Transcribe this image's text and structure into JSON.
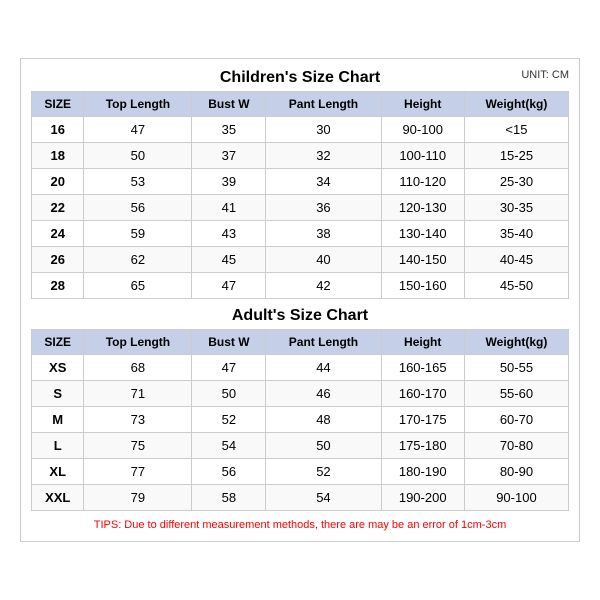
{
  "mainTitle": "Children's Size Chart",
  "unitLabel": "UNIT: CM",
  "childrenHeaders": [
    "SIZE",
    "Top Length",
    "Bust W",
    "Pant Length",
    "Height",
    "Weight(kg)"
  ],
  "childrenRows": [
    [
      "16",
      "47",
      "35",
      "30",
      "90-100",
      "<15"
    ],
    [
      "18",
      "50",
      "37",
      "32",
      "100-110",
      "15-25"
    ],
    [
      "20",
      "53",
      "39",
      "34",
      "110-120",
      "25-30"
    ],
    [
      "22",
      "56",
      "41",
      "36",
      "120-130",
      "30-35"
    ],
    [
      "24",
      "59",
      "43",
      "38",
      "130-140",
      "35-40"
    ],
    [
      "26",
      "62",
      "45",
      "40",
      "140-150",
      "40-45"
    ],
    [
      "28",
      "65",
      "47",
      "42",
      "150-160",
      "45-50"
    ]
  ],
  "adultTitle": "Adult's Size Chart",
  "adultHeaders": [
    "SIZE",
    "Top Length",
    "Bust W",
    "Pant Length",
    "Height",
    "Weight(kg)"
  ],
  "adultRows": [
    [
      "XS",
      "68",
      "47",
      "44",
      "160-165",
      "50-55"
    ],
    [
      "S",
      "71",
      "50",
      "46",
      "160-170",
      "55-60"
    ],
    [
      "M",
      "73",
      "52",
      "48",
      "170-175",
      "60-70"
    ],
    [
      "L",
      "75",
      "54",
      "50",
      "175-180",
      "70-80"
    ],
    [
      "XL",
      "77",
      "56",
      "52",
      "180-190",
      "80-90"
    ],
    [
      "XXL",
      "79",
      "58",
      "54",
      "190-200",
      "90-100"
    ]
  ],
  "tips": "TIPS: Due to different measurement methods, there are may be an error of 1cm-3cm"
}
